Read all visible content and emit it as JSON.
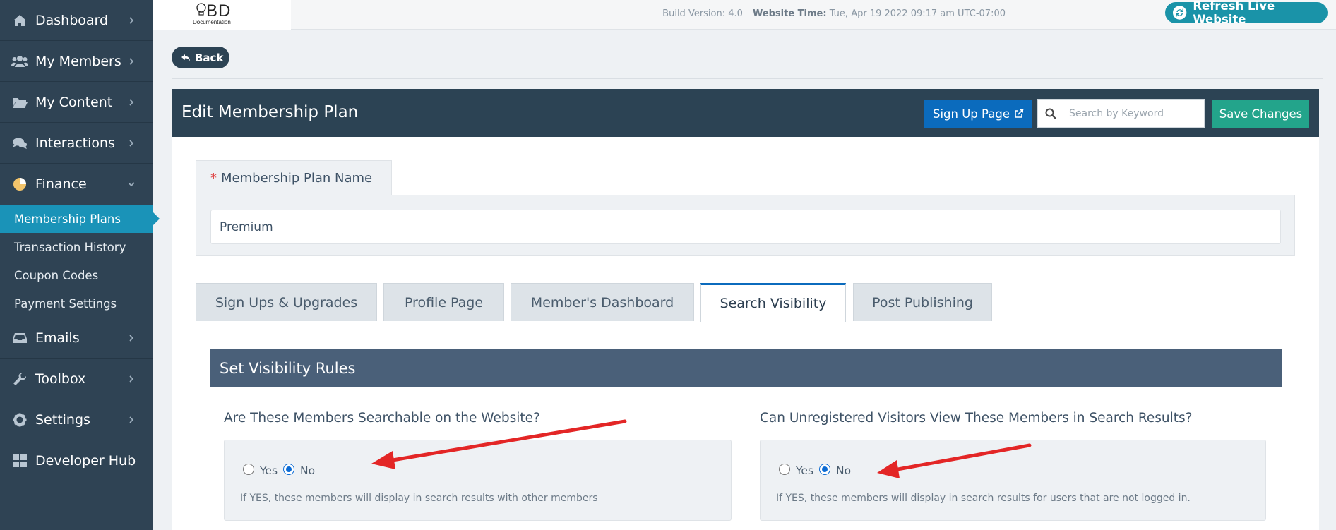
{
  "sidebar": {
    "items": [
      {
        "label": "Dashboard",
        "icon": "dashboard-icon"
      },
      {
        "label": "My Members",
        "icon": "users-icon"
      },
      {
        "label": "My Content",
        "icon": "folder-icon"
      },
      {
        "label": "Interactions",
        "icon": "comments-icon"
      },
      {
        "label": "Finance",
        "icon": "pie-chart-icon"
      },
      {
        "label": "Emails",
        "icon": "inbox-icon"
      },
      {
        "label": "Toolbox",
        "icon": "wrench-icon"
      },
      {
        "label": "Settings",
        "icon": "gear-icon"
      },
      {
        "label": "Developer Hub",
        "icon": "grid-icon"
      }
    ],
    "finance_sub": [
      {
        "label": "Membership Plans"
      },
      {
        "label": "Transaction History"
      },
      {
        "label": "Coupon Codes"
      },
      {
        "label": "Payment Settings"
      }
    ]
  },
  "topbar": {
    "logo_text": "BD",
    "logo_sub": "Documentation",
    "build_label": "Build Version: 4.0",
    "time_label": "Website Time:",
    "time_value": "Tue, Apr 19 2022 09:17 am UTC-07:00",
    "refresh_label": "Refresh Live Website"
  },
  "back_label": "Back",
  "header": {
    "title": "Edit Membership Plan",
    "signup_label": "Sign Up Page",
    "search_placeholder": "Search by Keyword",
    "save_label": "Save Changes"
  },
  "plan": {
    "required_mark": "*",
    "tab_label": "Membership Plan Name",
    "value": "Premium"
  },
  "tabs": [
    {
      "label": "Sign Ups & Upgrades"
    },
    {
      "label": "Profile Page"
    },
    {
      "label": "Member's Dashboard"
    },
    {
      "label": "Search Visibility"
    },
    {
      "label": "Post Publishing"
    }
  ],
  "active_tab": "Search Visibility",
  "visibility": {
    "section_title": "Set Visibility Rules",
    "q1": {
      "question": "Are These Members Searchable on the Website?",
      "yes": "Yes",
      "no": "No",
      "selected": "No",
      "help": "If YES, these members will display in search results with other members"
    },
    "q2": {
      "question": "Can Unregistered Visitors View These Members in Search Results?",
      "yes": "Yes",
      "no": "No",
      "selected": "No",
      "help": "If YES, these members will display in search results for users that are not logged in."
    }
  },
  "colors": {
    "sidebar_bg": "#2f4354",
    "active_sub": "#1a93b8",
    "header_bg": "#2c4354",
    "primary_blue": "#0b6bbd",
    "save_green": "#23a48b",
    "rules_bar": "#4a6079",
    "arrow_red": "#e32626"
  }
}
